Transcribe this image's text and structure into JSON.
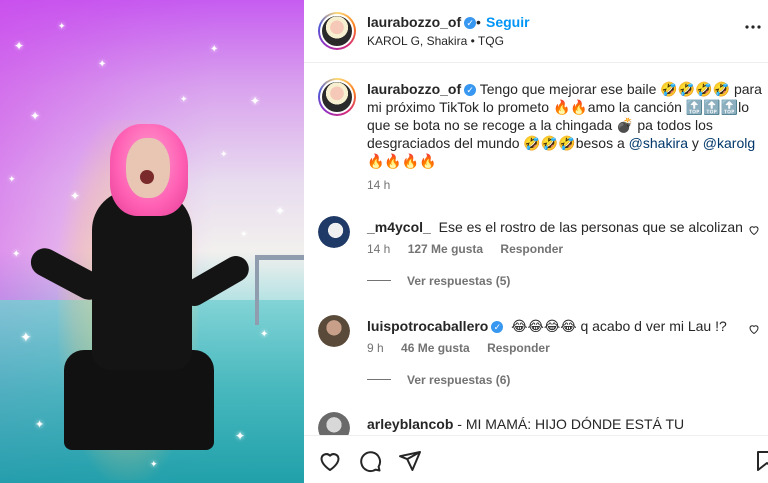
{
  "post": {
    "username": "laurabozzo_of",
    "verified_glyph": "✓",
    "separator": "•",
    "follow_label": "Seguir",
    "audio": "KAROL G, Shakira • TQG"
  },
  "caption": {
    "username": "laurabozzo_of",
    "part1": "Tengo que mejorar ese baile 🤣🤣🤣🤣 para mi próximo TikTok lo prometo 🔥🔥amo la canción 🔝🔝🔝lo que se bota no se recoge a la chingada 💣 pa todos los desgraciados del mundo 🤣🤣🤣besos a ",
    "mention1": "@shakira",
    "joiner": " y ",
    "mention2": "@karolg",
    "part2": " 🔥🔥🔥🔥",
    "time": "14 h"
  },
  "comments": [
    {
      "username": "_m4ycol_",
      "text": "Ese es el rostro de las personas que se alcolizan",
      "time": "14 h",
      "likes": "127 Me gusta",
      "reply": "Responder",
      "view_replies": "Ver respuestas (5)"
    },
    {
      "username": "luispotrocaballero",
      "text": "😂😂😂😂 q acabo d ver mi Lau !?",
      "time": "9 h",
      "likes": "46 Me gusta",
      "reply": "Responder",
      "view_replies": "Ver respuestas (6)"
    },
    {
      "username": "arleyblancob",
      "text": "MI MAMÁ: HIJO DÓNDE ESTÁ TU ABUELA?"
    }
  ],
  "icons": {
    "like": "heart-icon",
    "comment": "comment-icon",
    "share": "send-icon",
    "save": "bookmark-icon"
  },
  "colors": {
    "accent": "#0095f6",
    "verified": "#3897f0",
    "secondary_text": "#737373"
  }
}
